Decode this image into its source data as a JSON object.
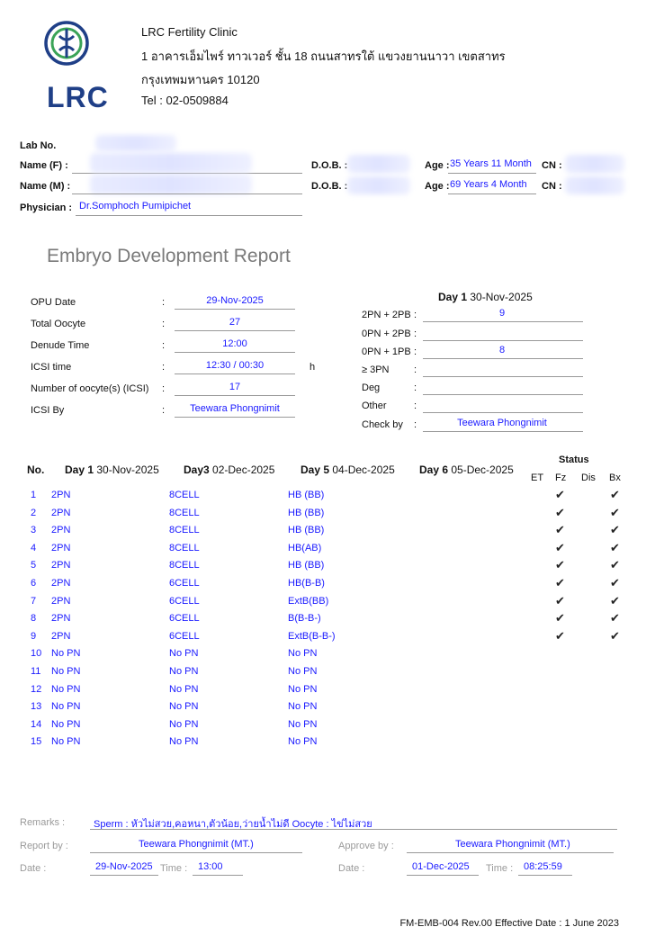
{
  "clinic": {
    "name": "LRC Fertility Clinic",
    "address1": "1 อาคารเอ็มไพร์ ทาวเวอร์ ชั้น 18 ถนนสาทรใต้ แขวงยานนาวา เขตสาทร",
    "address2": "กรุงเทพมหานคร 10120",
    "tel": "Tel : 02-0509884",
    "logo_text": "LRC"
  },
  "patient": {
    "lab_label": "Lab No.",
    "name_f_label": "Name (F) :",
    "name_m_label": "Name (M) :",
    "physician_label": "Physician :",
    "physician": "Dr.Somphoch Pumipichet",
    "dob_label": "D.O.B. :",
    "age_label": "Age :",
    "age_f": "35 Years 11 Month",
    "age_m": "69 Years 4 Month",
    "cn_label": "CN :"
  },
  "report_title": "Embryo Development Report",
  "opu": {
    "rows": [
      {
        "label": "OPU Date",
        "value": "29-Nov-2025",
        "unit": ""
      },
      {
        "label": "Total Oocyte",
        "value": "27",
        "unit": ""
      },
      {
        "label": "Denude Time",
        "value": "12:00",
        "unit": ""
      },
      {
        "label": "ICSI time",
        "value": "12:30 / 00:30",
        "unit": "h"
      },
      {
        "label": "Number of oocyte(s) (ICSI)",
        "value": "17",
        "unit": ""
      },
      {
        "label": "ICSI By",
        "value": "Teewara Phongnimit",
        "unit": ""
      }
    ]
  },
  "day1": {
    "title": "Day 1",
    "date": "30-Nov-2025",
    "rows": [
      {
        "label": "2PN + 2PB",
        "value": "9"
      },
      {
        "label": "0PN + 2PB",
        "value": ""
      },
      {
        "label": "0PN + 1PB",
        "value": "8"
      },
      {
        "label": "≥ 3PN",
        "value": ""
      },
      {
        "label": "Deg",
        "value": ""
      },
      {
        "label": "Other",
        "value": ""
      },
      {
        "label": "Check by",
        "value": "Teewara Phongnimit"
      }
    ]
  },
  "table": {
    "headers": {
      "no": "No.",
      "d1": "Day 1",
      "d1_date": "30-Nov-2025",
      "d3": "Day3",
      "d3_date": "02-Dec-2025",
      "d5": "Day 5",
      "d5_date": "04-Dec-2025",
      "d6": "Day 6",
      "d6_date": "05-Dec-2025",
      "status": "Status",
      "et": "ET",
      "fz": "Fz",
      "dis": "Dis",
      "bx": "Bx"
    },
    "check_mark": "✔",
    "rows": [
      {
        "no": "1",
        "d1": "2PN",
        "d3": "8CELL",
        "d5": "HB (BB)",
        "fz": true,
        "bx": true
      },
      {
        "no": "2",
        "d1": "2PN",
        "d3": "8CELL",
        "d5": "HB (BB)",
        "fz": true,
        "bx": true
      },
      {
        "no": "3",
        "d1": "2PN",
        "d3": "8CELL",
        "d5": "HB (BB)",
        "fz": true,
        "bx": true
      },
      {
        "no": "4",
        "d1": "2PN",
        "d3": "8CELL",
        "d5": "HB(AB)",
        "fz": true,
        "bx": true
      },
      {
        "no": "5",
        "d1": "2PN",
        "d3": "8CELL",
        "d5": "HB (BB)",
        "fz": true,
        "bx": true
      },
      {
        "no": "6",
        "d1": "2PN",
        "d3": "6CELL",
        "d5": "HB(B-B)",
        "fz": true,
        "bx": true
      },
      {
        "no": "7",
        "d1": "2PN",
        "d3": "6CELL",
        "d5": "ExtB(BB)",
        "fz": true,
        "bx": true
      },
      {
        "no": "8",
        "d1": "2PN",
        "d3": "6CELL",
        "d5": "B(B-B-)",
        "fz": true,
        "bx": true
      },
      {
        "no": "9",
        "d1": "2PN",
        "d3": "6CELL",
        "d5": "ExtB(B-B-)",
        "fz": true,
        "bx": true
      },
      {
        "no": "10",
        "d1": "No PN",
        "d3": "No PN",
        "d5": "No PN",
        "fz": false,
        "bx": false
      },
      {
        "no": "11",
        "d1": "No PN",
        "d3": "No PN",
        "d5": "No PN",
        "fz": false,
        "bx": false
      },
      {
        "no": "12",
        "d1": "No PN",
        "d3": "No PN",
        "d5": "No PN",
        "fz": false,
        "bx": false
      },
      {
        "no": "13",
        "d1": "No PN",
        "d3": "No PN",
        "d5": "No PN",
        "fz": false,
        "bx": false
      },
      {
        "no": "14",
        "d1": "No PN",
        "d3": "No PN",
        "d5": "No PN",
        "fz": false,
        "bx": false
      },
      {
        "no": "15",
        "d1": "No PN",
        "d3": "No PN",
        "d5": "No PN",
        "fz": false,
        "bx": false
      }
    ]
  },
  "footer": {
    "remarks_label": "Remarks :",
    "remarks": "Sperm : หัวไม่สวย,คอหนา,ตัวน้อย,ว่ายน้ำไม่ดี   Oocyte : ไข่ไม่สวย",
    "report_by_label": "Report by :",
    "report_by": "Teewara Phongnimit (MT.)",
    "approve_by_label": "Approve by :",
    "approve_by": "Teewara Phongnimit (MT.)",
    "date_label": "Date :",
    "time_label": "Time :",
    "report_date": "29-Nov-2025",
    "report_time": "13:00",
    "approve_date": "01-Dec-2025",
    "approve_time": "08:25:59",
    "form_code": "FM-EMB-004 Rev.00 Effective Date : 1 June 2023"
  },
  "colors": {
    "accent": "#1a1aff",
    "logo": "#1f3f87",
    "logo_green": "#3aa357",
    "title_gray": "#7a7a7a"
  }
}
